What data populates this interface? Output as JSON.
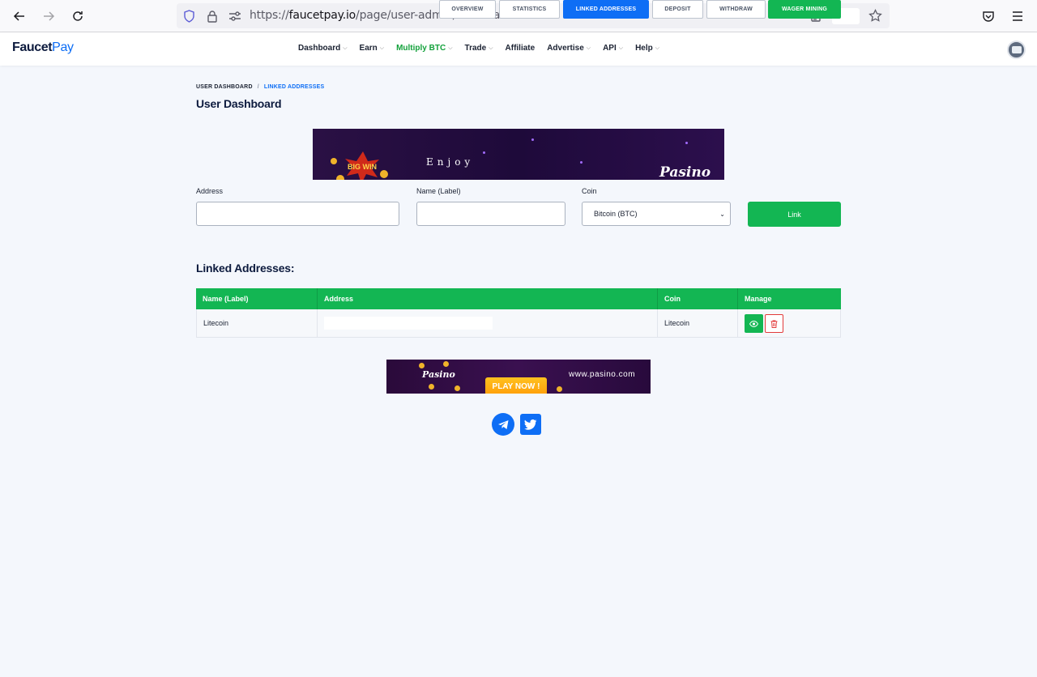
{
  "browser": {
    "url_prefix": "https://",
    "url_host": "faucetpay.io",
    "url_path": "/page/user-admin/linked-addresses"
  },
  "header": {
    "logo_part1": "Faucet",
    "logo_part2": "Pay",
    "menu": [
      {
        "label": "Dashboard",
        "dropdown": true
      },
      {
        "label": "Earn",
        "dropdown": true
      },
      {
        "label": "Multiply BTC",
        "dropdown": true
      },
      {
        "label": "Trade",
        "dropdown": true
      },
      {
        "label": "Affiliate",
        "dropdown": false
      },
      {
        "label": "Advertise",
        "dropdown": true
      },
      {
        "label": "API",
        "dropdown": true
      },
      {
        "label": "Help",
        "dropdown": true
      }
    ]
  },
  "breadcrumb": {
    "root": "USER DASHBOARD",
    "separator": "/",
    "current": "LINKED ADDRESSES"
  },
  "page_title": "User Dashboard",
  "tabs": [
    {
      "label": "OVERVIEW"
    },
    {
      "label": "STATISTICS"
    },
    {
      "label": "LINKED ADDRESSES"
    },
    {
      "label": "DEPOSIT"
    },
    {
      "label": "WITHDRAW"
    },
    {
      "label": "WAGER MINING"
    }
  ],
  "banner_top": {
    "badge": "BIG WIN",
    "tagline": "Enjoy",
    "brand": "Pasino"
  },
  "form": {
    "address_label": "Address",
    "address_value": "",
    "name_label": "Name (Label)",
    "name_value": "",
    "coin_label": "Coin",
    "coin_selected": "Bitcoin (BTC)",
    "link_button": "Link"
  },
  "linked": {
    "title": "Linked Addresses:",
    "columns": [
      "Name (Label)",
      "Address",
      "Coin",
      "Manage"
    ],
    "rows": [
      {
        "name": "Litecoin",
        "address": "",
        "coin": "Litecoin"
      }
    ]
  },
  "banner_bottom": {
    "brand": "Pasino",
    "cta": "PLAY NOW !",
    "site": "www.pasino.com"
  },
  "colors": {
    "accent_blue": "#0e6ef5",
    "accent_green": "#13b653",
    "danger": "#e23a3a"
  }
}
